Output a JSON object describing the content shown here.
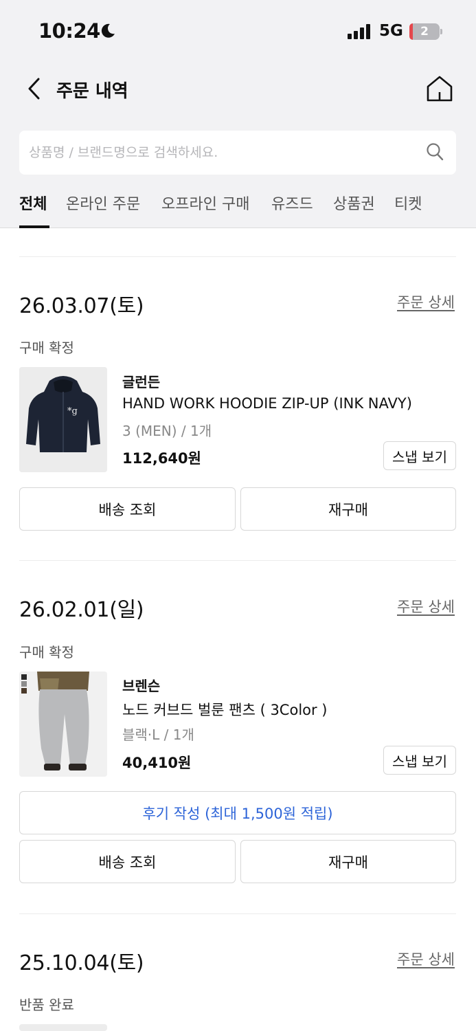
{
  "status_bar": {
    "time": "10:24",
    "network": "5G",
    "battery": "2"
  },
  "header": {
    "title": "주문 내역"
  },
  "search": {
    "placeholder": "상품명 / 브랜드명으로 검색하세요."
  },
  "tabs": [
    {
      "label": "전체",
      "active": true
    },
    {
      "label": "온라인 주문"
    },
    {
      "label": "오프라인 구매"
    },
    {
      "label": "유즈드"
    },
    {
      "label": "상품권"
    },
    {
      "label": "티켓"
    }
  ],
  "orders": [
    {
      "date": "26.03.07(토)",
      "detail_label": "주문 상세",
      "status": "구매 확정",
      "brand": "글런든",
      "name": "HAND WORK HOODIE ZIP-UP (INK NAVY)",
      "option": "3 (MEN) / 1개",
      "price": "112,640원",
      "snap_label": "스냅 보기",
      "buttons": {
        "track": "배송 조회",
        "reorder": "재구매"
      }
    },
    {
      "date": "26.02.01(일)",
      "detail_label": "주문 상세",
      "status": "구매 확정",
      "brand": "브렌슨",
      "name": "노드 커브드 벌룬 팬츠 ( 3Color )",
      "option": "블랙·L / 1개",
      "price": "40,410원",
      "snap_label": "스냅 보기",
      "review_label": "후기 작성 (최대 1,500원 적립)",
      "buttons": {
        "track": "배송 조회",
        "reorder": "재구매"
      }
    },
    {
      "date": "25.10.04(토)",
      "detail_label": "주문 상세",
      "status": "반품 완료"
    }
  ],
  "colors": {
    "accent_blue": "#2d64d8",
    "header_bg": "#f2f2f4",
    "battery_low": "#e5484d"
  }
}
